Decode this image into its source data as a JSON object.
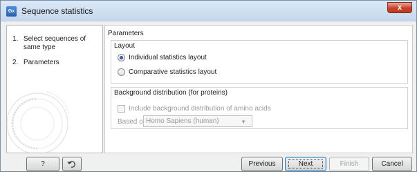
{
  "window": {
    "title": "Sequence statistics",
    "app_icon_text": "Gx",
    "close_label": "x"
  },
  "steps": [
    {
      "number": "1.",
      "label": "Select sequences of same type"
    },
    {
      "number": "2.",
      "label": "Parameters"
    }
  ],
  "content": {
    "section_title": "Parameters",
    "layout_group": {
      "title": "Layout",
      "options": [
        {
          "label": "Individual statistics layout",
          "selected": true
        },
        {
          "label": "Comparative statistics layout",
          "selected": false
        }
      ]
    },
    "background_group": {
      "title": "Background distribution (for proteins)",
      "checkbox_label": "Include background distribution of amino acids",
      "checkbox_checked": false,
      "based_on_label": "Based on",
      "based_on_value": "Homo Sapiens (human)"
    }
  },
  "buttons": {
    "help": "?",
    "previous": "Previous",
    "next": "Next",
    "finish": "Finish",
    "cancel": "Cancel"
  }
}
